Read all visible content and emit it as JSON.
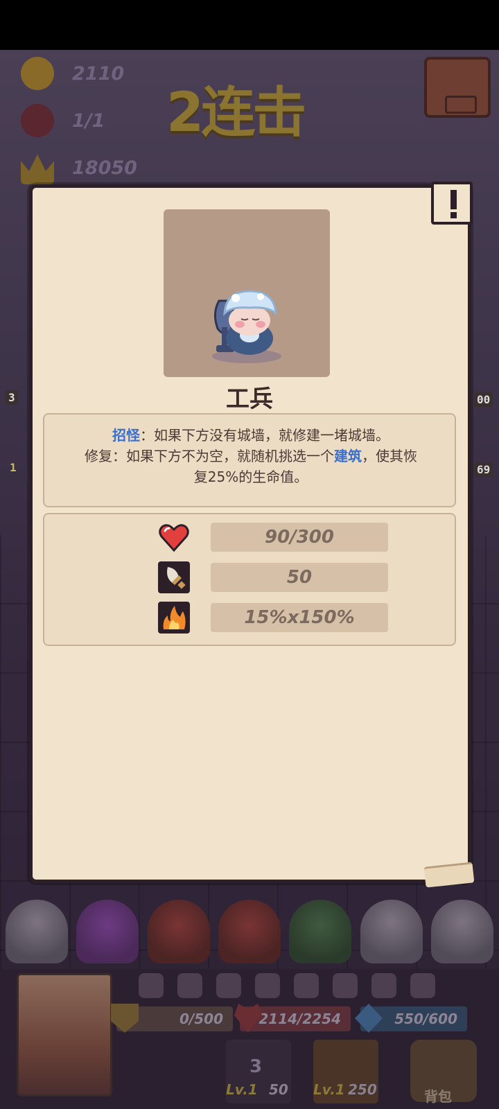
{
  "hud": {
    "gold": "2110",
    "monsters": "1/1",
    "score": "18050",
    "combo_title": "2连击"
  },
  "side_numbers": {
    "left_top": "3",
    "left_bottom": "1",
    "right_top": "00",
    "right_bottom": "69"
  },
  "card": {
    "title": "工兵",
    "description": {
      "line1": [
        {
          "text": "招怪",
          "keyword": true
        },
        {
          "text": "：如果下方没有城墙，就修建一堵城墙。",
          "keyword": false
        }
      ],
      "line2": [
        {
          "text": "修复：如果下方不为空，就随机挑选一个",
          "keyword": false
        },
        {
          "text": "建筑",
          "keyword": true
        },
        {
          "text": "，使其恢",
          "keyword": false
        }
      ],
      "line3": [
        {
          "text": "复25%的生命值。",
          "keyword": false
        }
      ]
    },
    "stats": {
      "hp": "90/300",
      "attack": "50",
      "crit": "15%x150%"
    }
  },
  "bottom": {
    "shield": "0/500",
    "hp": "2114/2254",
    "mana": "550/600",
    "center_count": "3",
    "level_left": "Lv.1",
    "level_left_cost": "50",
    "level_right": "Lv.1",
    "level_right_cost": "250",
    "backpack_label": "背包"
  },
  "colors": {
    "card_bg": "#f1e3cc",
    "card_border": "#2d1f27",
    "keyword": "#3a6fd0",
    "heart": "#e2403e",
    "fire": "#f08a2a"
  },
  "icons": {
    "hp": "heart-icon",
    "attack": "sword-icon",
    "crit": "fire-icon",
    "info": "exclamation-icon"
  }
}
